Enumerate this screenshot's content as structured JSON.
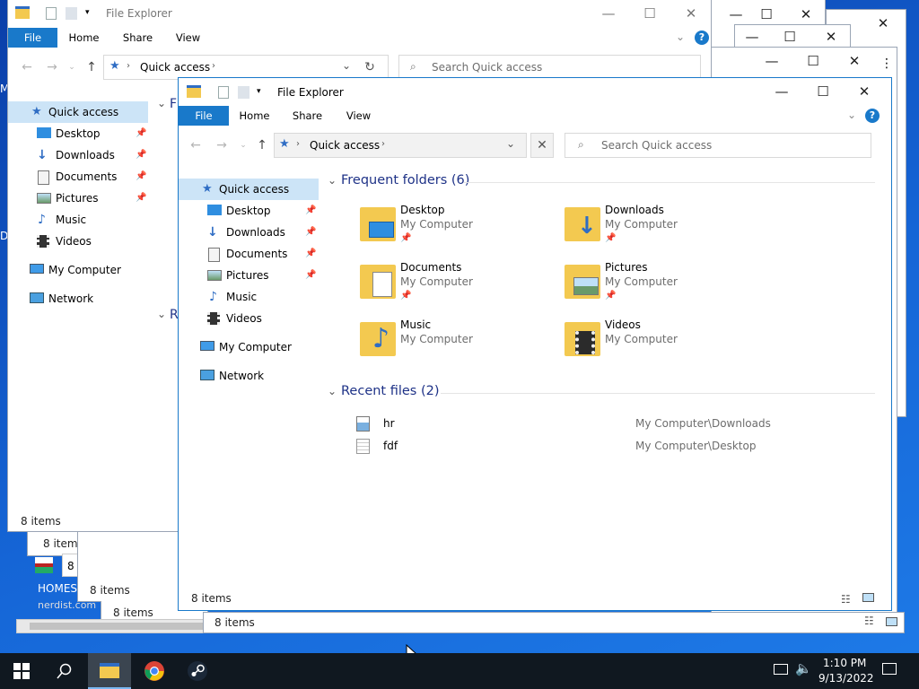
{
  "explorer": {
    "title": "File Explorer",
    "tabs": [
      "File",
      "Home",
      "Share",
      "View"
    ],
    "address_label": "Quick access",
    "search_placeholder": "Search Quick access",
    "status": "8 items",
    "nav": {
      "quick_access": "Quick access",
      "items": [
        {
          "label": "Desktop",
          "icon": "desktop-icon",
          "pinned": true
        },
        {
          "label": "Downloads",
          "icon": "downloads-icon",
          "pinned": true
        },
        {
          "label": "Documents",
          "icon": "documents-icon",
          "pinned": true
        },
        {
          "label": "Pictures",
          "icon": "pictures-icon",
          "pinned": true
        },
        {
          "label": "Music",
          "icon": "music-icon",
          "pinned": false
        },
        {
          "label": "Videos",
          "icon": "videos-icon",
          "pinned": false
        }
      ],
      "my_computer": "My Computer",
      "network": "Network"
    },
    "frequent": {
      "title": "Frequent folders (6)",
      "folders": [
        {
          "name": "Desktop",
          "location": "My Computer",
          "pinned": true,
          "icon": "desktop-folder-icon"
        },
        {
          "name": "Downloads",
          "location": "My Computer",
          "pinned": true,
          "icon": "downloads-folder-icon"
        },
        {
          "name": "Documents",
          "location": "My Computer",
          "pinned": true,
          "icon": "documents-folder-icon"
        },
        {
          "name": "Pictures",
          "location": "My Computer",
          "pinned": true,
          "icon": "pictures-folder-icon"
        },
        {
          "name": "Music",
          "location": "My Computer",
          "pinned": false,
          "icon": "music-folder-icon"
        },
        {
          "name": "Videos",
          "location": "My Computer",
          "pinned": false,
          "icon": "videos-folder-icon"
        }
      ]
    },
    "recent": {
      "title": "Recent files (2)",
      "files": [
        {
          "name": "hr",
          "path": "My Computer\\Downloads",
          "icon": "image-file-icon"
        },
        {
          "name": "fdf",
          "path": "My Computer\\Desktop",
          "icon": "text-file-icon"
        }
      ]
    }
  },
  "background_window": {
    "section_frequent_fragment": "F",
    "section_recent_fragment": "R"
  },
  "desktop": {
    "left_edge_letters": [
      "M",
      "D"
    ],
    "shortcut_title": "HOMES",
    "shortcut_sub": "nerdist.com",
    "stacked_status": [
      "8 items",
      "8 items",
      "8 items",
      "8 items",
      "8 items",
      "8 i"
    ]
  },
  "taskbar": {
    "time": "1:10 PM",
    "date": "9/13/2022",
    "apps": [
      "file-explorer-icon",
      "chrome-icon",
      "steam-icon"
    ]
  },
  "colors": {
    "accent": "#1979ca",
    "section_title": "#1e3287",
    "folder_yellow": "#f3c950",
    "taskbar": "#101820"
  }
}
